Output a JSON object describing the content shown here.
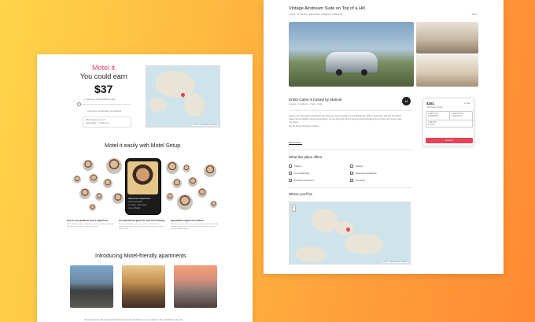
{
  "left_page": {
    "hero": {
      "brand": "Motel it.",
      "headline": "You could earn",
      "amount": "$37",
      "note": "1 night at an estimated $37 a night",
      "cta": "Learn how we estimate your earnings",
      "place_label": "Which place are you?",
      "place_value": "Entire place · 2 bedrooms"
    },
    "setup_title": "Motel it easily with Motel Setup",
    "phone_card": {
      "title": "Welcome! Superhost",
      "lines": [
        "Hosts since 2019",
        "4.9 rating · 120 reviews",
        "Lives in Manila"
      ]
    },
    "features": [
      {
        "title": "One-to-one guidance from a Superhost",
        "desc": "We'll match you with a Superhost in your area who'll guide you from your first question to your first guest."
      },
      {
        "title": "An experienced guest for your first booking",
        "desc": "For your first booking, you can choose to welcome an experienced guest who has at least three stays and a good track record."
      },
      {
        "title": "Specialised support from Motel",
        "desc": "New Hosts get one-tap access to specially trained Community Support agents who can help with everything from account issues to billing support."
      }
    ],
    "apartments_title": "Introducing Motel-friendly apartments",
    "bottom_text": "We've partnered with apartment buildings across the US that let you rent a place to live and Motel it part-time."
  },
  "right_page": {
    "title": "Vintage Airstream Suite on Top of a Hill",
    "meta": "★ New · No reviews · Dasmariñas, Calabarzon, Philippines",
    "save_label": "♡ Save",
    "host_title": "Entire Cabin is hosted by Mahedi",
    "host_meta": "2 guests · 1 bedroom · 1 bed · 1 bath",
    "host_initial": "M",
    "description": [
      "Escape and Travel gives itself at the first Airstream accommodation in the Philippines. With its sea-reflect blend of thoughtful design and its location nature-surroundings, we can bring the spirit of camping while embracing the comforts of a luxury hotel.",
      "The space",
      "The 20 Series Airstream includes..."
    ],
    "show_more": "Show more  ›",
    "offers_title": "What this place offers",
    "amenities": [
      "Kitchen",
      "Washer",
      "Air conditioning",
      "Dedicated workspace",
      "Exercise equipment",
      "Hot water"
    ],
    "where_title": "Where you'll be",
    "booking": {
      "price": "$251",
      "rating": "★ New",
      "sub": "Total before taxes",
      "checkin_label": "CHECK-IN",
      "checkin_value": "10/06/2023",
      "checkout_label": "CHECKOUT",
      "checkout_value": "10/11/2023",
      "guests_label": "GUESTS",
      "guests_value": "1 guest",
      "reserve": "Reserve"
    }
  },
  "map_attribution": "Leaflet | © OpenStreetMap contributors",
  "colors": {
    "accent": "#e8415a",
    "background_start": "#ffd54a",
    "background_end": "#ff8a33"
  }
}
